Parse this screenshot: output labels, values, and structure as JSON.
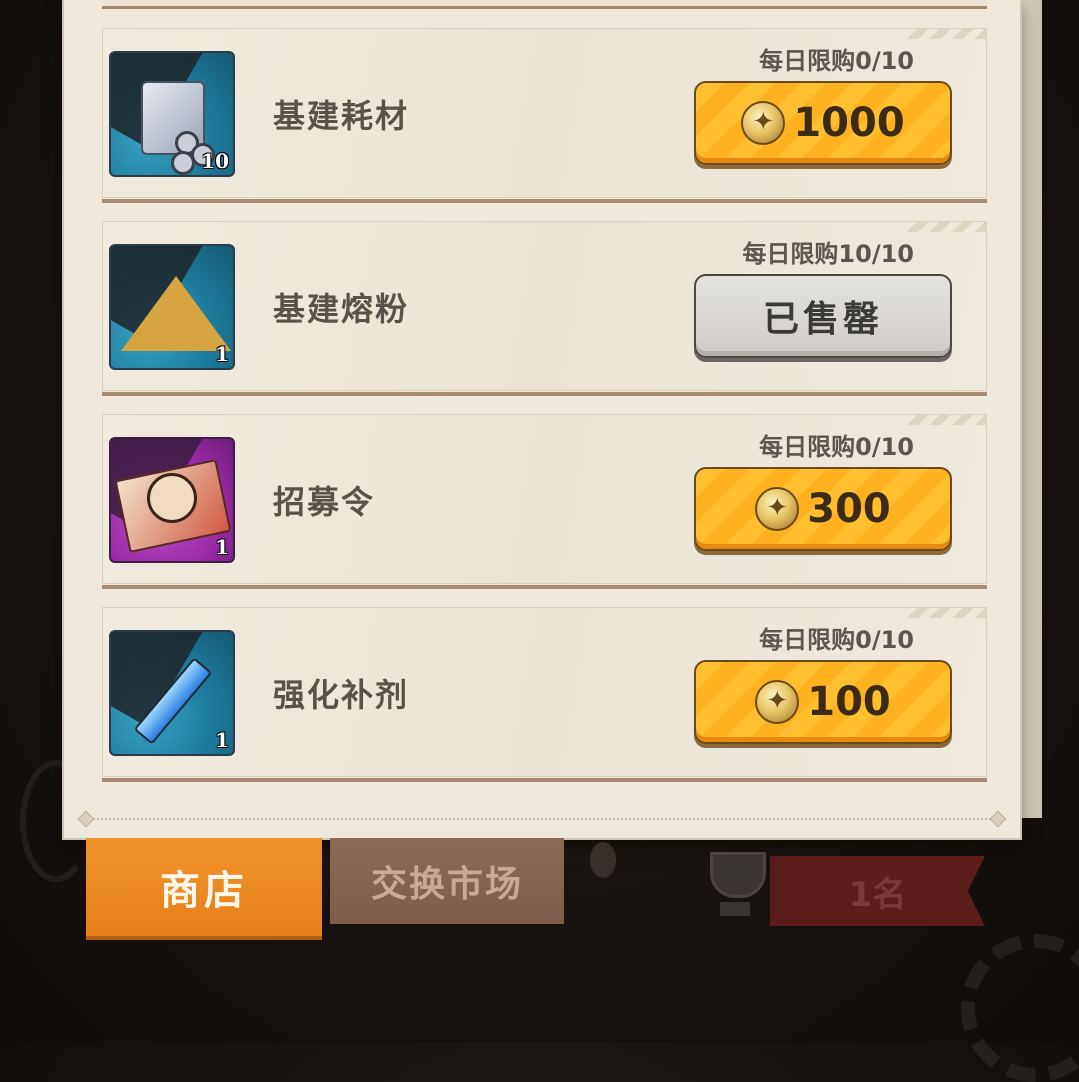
{
  "shop": {
    "items": [
      {
        "name": "基建耗材",
        "qty": "10",
        "limit": "每日限购0/10",
        "price": "1000",
        "sold_out": false
      },
      {
        "name": "基建熔粉",
        "qty": "1",
        "limit": "每日限购10/10",
        "sold_label": "已售罄",
        "sold_out": true
      },
      {
        "name": "招募令",
        "qty": "1",
        "limit": "每日限购0/10",
        "price": "300",
        "sold_out": false
      },
      {
        "name": "强化补剂",
        "qty": "1",
        "limit": "每日限购0/10",
        "price": "100",
        "sold_out": false
      }
    ]
  },
  "tabs": {
    "shop": "商店",
    "exchange": "交换市场"
  },
  "rank": {
    "label": "1名"
  },
  "colors": {
    "accent": "#f0932c",
    "buy_button": "#ffbf2f",
    "panel": "#efe9dd"
  },
  "icons": {
    "currency": "eagle-medal-coin-icon"
  }
}
